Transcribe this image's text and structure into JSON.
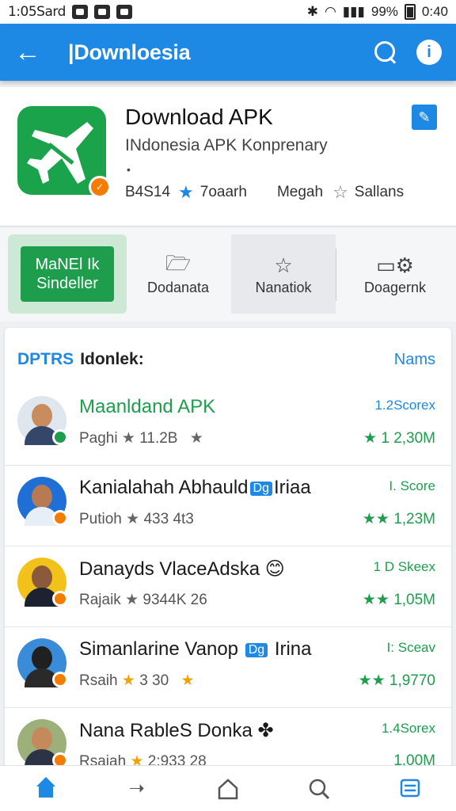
{
  "status_bar": {
    "time_left": "1:05Sard",
    "battery": "99%",
    "time_right": "0:40"
  },
  "app_bar": {
    "title": "|Downloesia"
  },
  "app": {
    "name": "Download APK",
    "subtitle": "INdonesia APK Konprenary",
    "dot": "•",
    "rating_count": "B4S14",
    "rating": "7oaarh",
    "size": "Megah",
    "reviews": "Sallans",
    "badge": "✓"
  },
  "actions": {
    "primary_line1": "MaNEl Ik",
    "primary_line2": "Sindeller",
    "item1": "Dodanata",
    "item2": "Nanatiok",
    "item3": "Doagernk"
  },
  "list": {
    "tag": "DPTRS",
    "label": "Idonlek:",
    "more": "Nams",
    "rows": [
      {
        "name": "Maanldand APK",
        "sub_prefix": "Paghi",
        "sub_star": "★",
        "sub_value": "11.2B",
        "sub_extra": "★",
        "score": "1.2Scorex",
        "downloads": "★ 1 2,30M"
      },
      {
        "name_pre": "Kanialahah Abhauld",
        "chip": "Dg",
        "name_post": "Iriaa",
        "sub_prefix": "Putioh",
        "sub_star": "★",
        "sub_value": "433 4t3",
        "sub_extra": "",
        "score": "I. Score",
        "downloads": "★★ 1,23M"
      },
      {
        "name": "Danayds VlaceAdska 😊",
        "sub_prefix": "Rajaik",
        "sub_star": "★",
        "sub_value": "9344K 26",
        "sub_extra": "",
        "score": "1 D Skeex",
        "downloads": "★★ 1,05M"
      },
      {
        "name_pre": "Simanlarine Vanop",
        "chip": "Dg",
        "name_post": "Irina",
        "sub_prefix": "Rsaih",
        "sub_star": "★",
        "sub_value": "3 30",
        "sub_extra": "★",
        "score": "I: Sceav",
        "downloads": "★★ 1,9770"
      },
      {
        "name": "Nana RableS Donka ✤",
        "sub_prefix": "Rsaiah",
        "sub_star": "★",
        "sub_value": "2:933 28",
        "sub_extra": "",
        "score": "1.4Sorex",
        "downloads": "1.00M"
      }
    ]
  },
  "colors": {
    "primary": "#1e88e5",
    "green": "#1e9e4d",
    "orange_badge": "#f57c00",
    "gold_star": "#f0a20a"
  }
}
